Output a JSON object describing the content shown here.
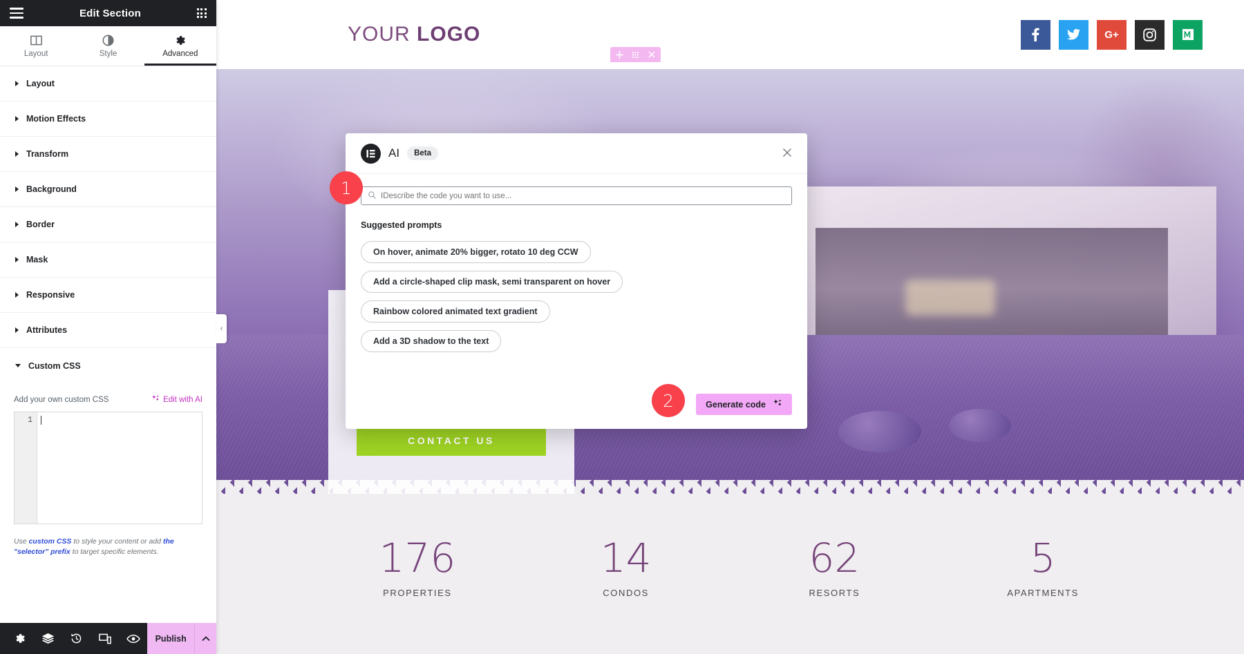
{
  "panel": {
    "title": "Edit Section",
    "menu_icon": "hamburger-icon",
    "apps_icon": "grid-apps-icon",
    "tabs": [
      {
        "label": "Layout",
        "icon": "layout-columns-icon",
        "active": false
      },
      {
        "label": "Style",
        "icon": "contrast-circle-icon",
        "active": false
      },
      {
        "label": "Advanced",
        "icon": "gear-icon",
        "active": true
      }
    ],
    "sections": [
      {
        "label": "Layout",
        "expanded": false
      },
      {
        "label": "Motion Effects",
        "expanded": false
      },
      {
        "label": "Transform",
        "expanded": false
      },
      {
        "label": "Background",
        "expanded": false
      },
      {
        "label": "Border",
        "expanded": false
      },
      {
        "label": "Mask",
        "expanded": false
      },
      {
        "label": "Responsive",
        "expanded": false
      },
      {
        "label": "Attributes",
        "expanded": false
      },
      {
        "label": "Custom CSS",
        "expanded": true
      }
    ],
    "custom_css": {
      "field_label": "Add your own custom CSS",
      "edit_with_ai": "Edit with AI",
      "line_number": "1",
      "code_value": "",
      "note_prefix": "Use ",
      "note_link1": "custom CSS",
      "note_mid": " to style your content or add ",
      "note_link2": "the \"selector\" prefix",
      "note_suffix": " to target specific elements."
    },
    "footer": {
      "icons": [
        "settings-gear-icon",
        "layers-navigator-icon",
        "history-revisions-icon",
        "responsive-mode-icon",
        "preview-eye-icon"
      ],
      "publish_label": "Publish",
      "publish_caret": "chevron-up-icon"
    },
    "collapse_handle": "‹"
  },
  "preview": {
    "logo": {
      "light": "YOUR",
      "bold": "LOGO"
    },
    "socials": [
      {
        "name": "facebook",
        "glyph": "f",
        "color": "#3b5998"
      },
      {
        "name": "twitter",
        "glyph": "t",
        "color": "#29a3f1"
      },
      {
        "name": "google-plus",
        "glyph": "G+",
        "color": "#e04a3b"
      },
      {
        "name": "instagram",
        "glyph": "i",
        "color": "#2b2b2b"
      },
      {
        "name": "medium",
        "glyph": "M",
        "color": "#0ca363"
      }
    ],
    "section_controls": [
      {
        "name": "add-section",
        "glyph": "+"
      },
      {
        "name": "drag-handle",
        "glyph": "⠿"
      },
      {
        "name": "delete-section",
        "glyph": "✕"
      }
    ],
    "cta_label": "CONTACT US",
    "cta_color": "#9fd423",
    "stats": [
      {
        "value": "176",
        "label": "PROPERTIES"
      },
      {
        "value": "14",
        "label": "CONDOS"
      },
      {
        "value": "62",
        "label": "RESORTS"
      },
      {
        "value": "5",
        "label": "APARTMENTS"
      }
    ]
  },
  "modal": {
    "brand_icon": "elementor-logo-icon",
    "title": "AI",
    "badge": "Beta",
    "close_icon": "close-icon",
    "search_icon": "search-icon",
    "input_value": "",
    "input_placeholder": "IDescribe the code you want to use...",
    "suggested_title": "Suggested prompts",
    "prompts": [
      "On hover, animate 20% bigger, rotato 10 deg CCW",
      "Add a circle-shaped clip mask, semi transparent on hover",
      "Rainbow colored animated text gradient",
      "Add a 3D shadow to the text"
    ],
    "generate_label": "Generate code",
    "generate_icon": "sparkle-icon"
  },
  "annotations": {
    "step1": "1",
    "step2": "2",
    "color": "#f8414a"
  }
}
